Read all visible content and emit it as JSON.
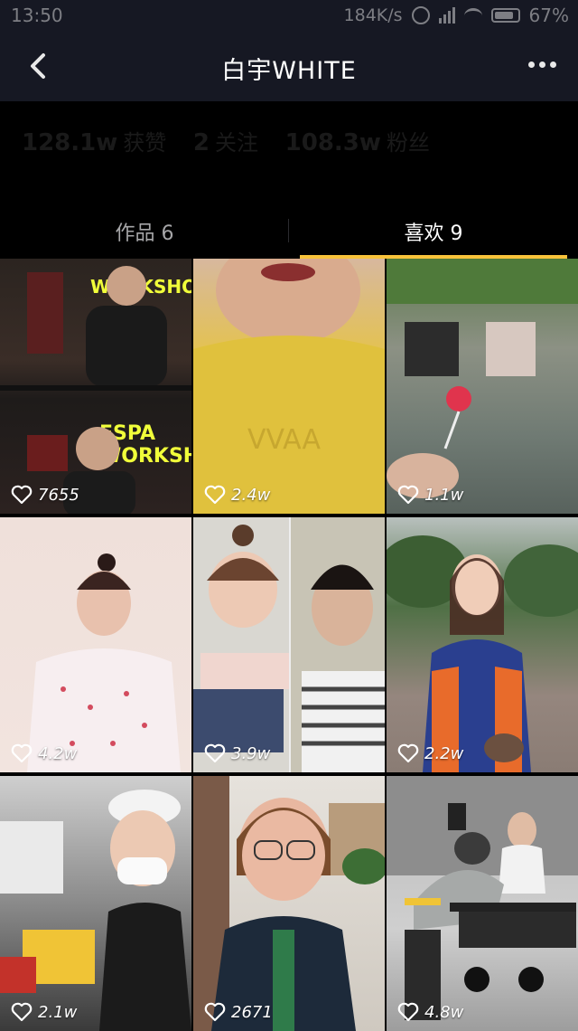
{
  "status_bar": {
    "time": "13:50",
    "speed": "184K/s",
    "battery": "67%"
  },
  "nav": {
    "title": "白宇WHITE",
    "back_icon": "chevron-left-icon",
    "more_icon": "more-dots-icon"
  },
  "stats": {
    "likes_value": "128.1w",
    "likes_label": "获赞",
    "following_value": "2",
    "following_label": "关注",
    "followers_value": "108.3w",
    "followers_label": "粉丝"
  },
  "tabs": [
    {
      "label": "作品 6"
    },
    {
      "label": "喜欢 9"
    }
  ],
  "colors": {
    "accent": "#f8c23a",
    "nav_bg": "#161823",
    "background": "#000000"
  },
  "videos": [
    {
      "likes": "7655"
    },
    {
      "likes": "2.4w"
    },
    {
      "likes": "1.1w"
    },
    {
      "likes": "4.2w"
    },
    {
      "likes": "3.9w"
    },
    {
      "likes": "2.2w"
    },
    {
      "likes": "2.1w"
    },
    {
      "likes": "2671"
    },
    {
      "likes": "4.8w"
    }
  ]
}
